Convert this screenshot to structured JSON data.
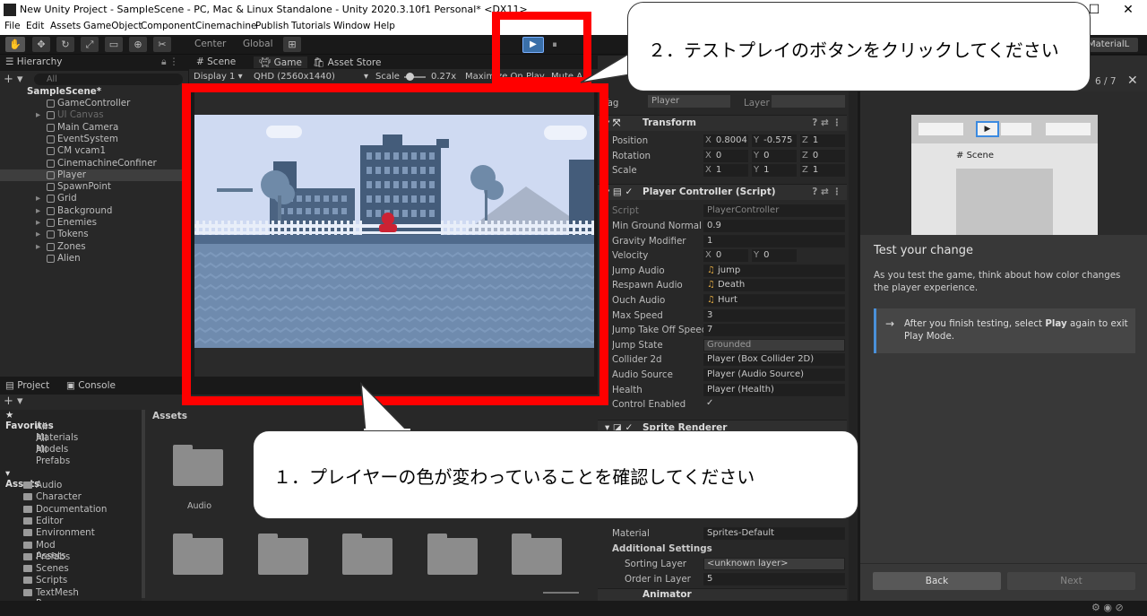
{
  "window": {
    "title": "New Unity Project - SampleScene - PC, Mac & Linux Standalone - Unity 2020.3.10f1 Personal* <DX11>",
    "min": "—",
    "max": "☐",
    "close": "✕"
  },
  "menu": [
    "File",
    "Edit",
    "Assets",
    "GameObject",
    "Component",
    "Cinemachine",
    "Publish",
    "Tutorials",
    "Window",
    "Help"
  ],
  "toolbar": {
    "pivot": "Center",
    "space": "Global",
    "layout": "MaterialL"
  },
  "hierarchy": {
    "tab": "Hierarchy",
    "search_placeholder": "All",
    "scene": "SampleScene*",
    "items": [
      "GameController",
      "UI Canvas",
      "Main Camera",
      "EventSystem",
      "CM vcam1",
      "CinemachineConfiner",
      "Player",
      "SpawnPoint",
      "Grid",
      "Background",
      "Enemies",
      "Tokens",
      "Zones",
      "Alien"
    ]
  },
  "game_view": {
    "tabs": [
      "Scene",
      "Game",
      "Asset Store"
    ],
    "display": "Display 1",
    "resolution": "QHD (2560x1440)",
    "scale_label": "Scale",
    "scale_value": "0.27x",
    "maximize": "Maximize On Play",
    "mute": "Mute A"
  },
  "project": {
    "tabs": [
      "Project",
      "Console"
    ],
    "favorites_label": "Favorites",
    "favorites": [
      "All Materials",
      "All Models",
      "All Prefabs"
    ],
    "assets_label": "Assets",
    "asset_folders": [
      "Audio",
      "Character",
      "Documentation",
      "Editor",
      "Environment",
      "Mod Assets",
      "Prefabs",
      "Scenes",
      "Scripts",
      "TextMesh Pro"
    ],
    "grid_header": "Assets",
    "grid_first_label": "Audio"
  },
  "inspector": {
    "tag_label": "Tag",
    "tag_value": "Player",
    "layer_label": "Layer",
    "transform": {
      "title": "Transform",
      "rows": [
        {
          "label": "Position",
          "x": "0.8004",
          "y": "-0.575",
          "z": "1"
        },
        {
          "label": "Rotation",
          "x": "0",
          "y": "0",
          "z": "0"
        },
        {
          "label": "Scale",
          "x": "1",
          "y": "1",
          "z": "1"
        }
      ]
    },
    "player_controller": {
      "title": "Player Controller (Script)",
      "script_label": "Script",
      "script_value": "PlayerController",
      "rows": [
        {
          "label": "Min Ground Normal Y",
          "value": "0.9"
        },
        {
          "label": "Gravity Modifier",
          "value": "1"
        },
        {
          "label": "Jump Audio",
          "value": "jump",
          "icon": "♫"
        },
        {
          "label": "Respawn Audio",
          "value": "Death",
          "icon": "♫"
        },
        {
          "label": "Ouch Audio",
          "value": "Hurt",
          "icon": "♫"
        },
        {
          "label": "Max Speed",
          "value": "3"
        },
        {
          "label": "Jump Take Off Speed",
          "value": "7"
        },
        {
          "label": "Jump State",
          "value": "Grounded"
        },
        {
          "label": "Collider 2d",
          "value": "Player (Box Collider 2D)"
        },
        {
          "label": "Audio Source",
          "value": "Player (Audio Source)"
        },
        {
          "label": "Health",
          "value": "Player (Health)"
        },
        {
          "label": "Control Enabled",
          "value": "✓"
        }
      ],
      "velocity_label": "Velocity",
      "velocity_x": "0",
      "velocity_y": "0"
    },
    "sprite_renderer_title": "Sprite Renderer",
    "material_label": "Material",
    "material_value": "Sprites-Default",
    "additional_settings": "Additional Settings",
    "sorting_layer_label": "Sorting Layer",
    "sorting_layer_value": "<unknown layer>",
    "order_label": "Order in Layer",
    "order_value": "5",
    "animator_title": "Animator"
  },
  "tutorial": {
    "progress": "6 / 7",
    "preview_label": "Scene",
    "heading": "Test your change",
    "body": "As you test the game, think about how color changes the player experience.",
    "tip_pre": "After you finish testing, select ",
    "tip_bold": "Play",
    "tip_post": " again to exit Play Mode.",
    "back": "Back",
    "next": "Next"
  },
  "annotations": {
    "callout_top": "２．テストプレイのボタンをクリックしてください",
    "callout_bottom": "１．プレイヤーの色が変わっていることを確認してください"
  },
  "colors": {
    "highlight_red": "#ff0000",
    "accent_blue": "#4a90d9",
    "player_red": "#cc2233"
  }
}
